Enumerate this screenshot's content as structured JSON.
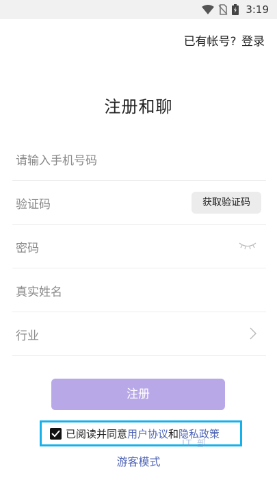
{
  "status_bar": {
    "time": "3:19",
    "icons": [
      "wifi-icon",
      "no-sim-icon",
      "battery-charging-icon"
    ]
  },
  "header": {
    "login_question": "已有帐号?",
    "login_link": "登录"
  },
  "title": "注册和聊",
  "form": {
    "phone_placeholder": "请输入手机号码",
    "code_placeholder": "验证码",
    "get_code_label": "获取验证码",
    "password_placeholder": "密码",
    "realname_placeholder": "真实姓名",
    "industry_placeholder": "行业"
  },
  "register_label": "注册",
  "agreement": {
    "checked": true,
    "prefix": "已阅读并同意",
    "user_agreement": "用户协议",
    "and": "和",
    "privacy_policy": "隐私政策"
  },
  "guest_mode": "游客模式",
  "watermark": "IT 部"
}
